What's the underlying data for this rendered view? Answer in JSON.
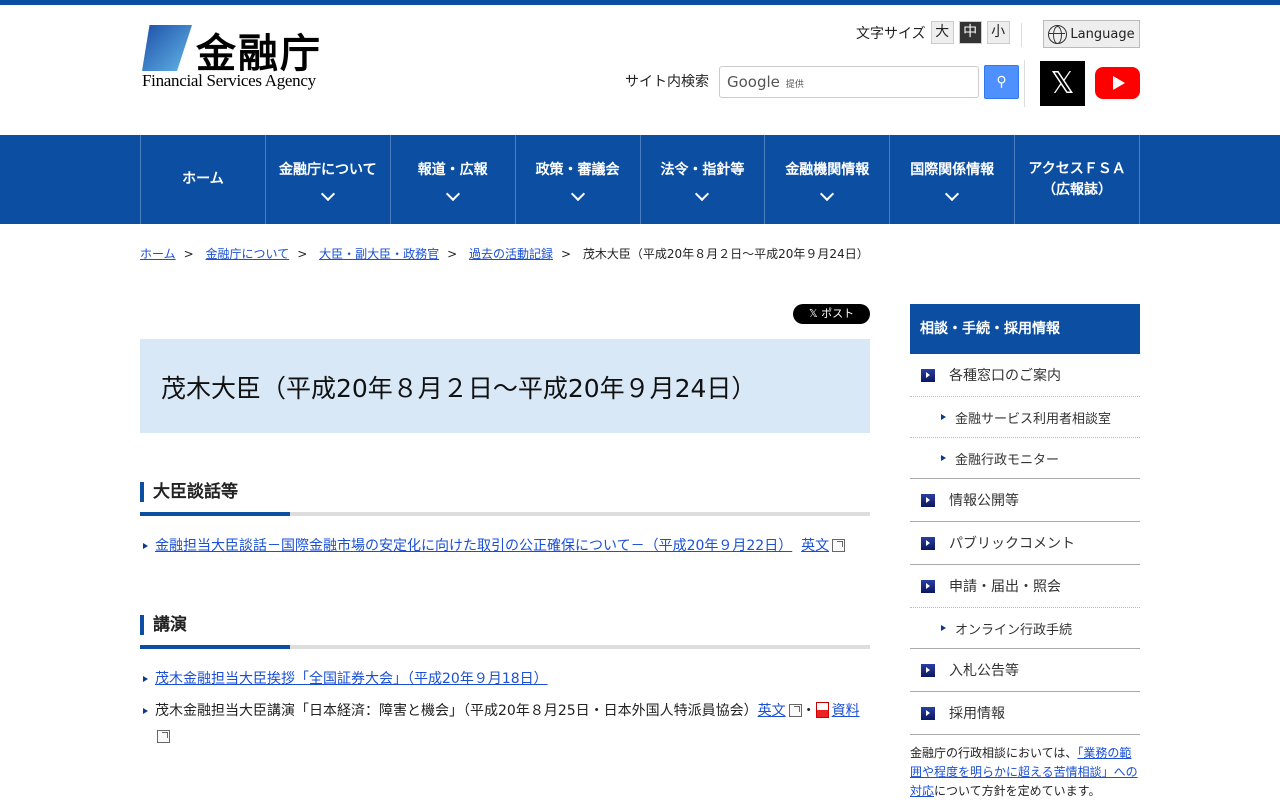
{
  "header": {
    "logo_kanji": "金融庁",
    "logo_en": "Financial Services Agency",
    "font_size_label": "文字サイズ",
    "font_sizes": [
      "大",
      "中",
      "小"
    ],
    "language": "Language",
    "search_label": "サイト内検索",
    "search_placeholder": "Google",
    "search_provided": "提供",
    "x_label": "𝕏"
  },
  "nav": [
    {
      "label": "ホーム"
    },
    {
      "label": "金融庁について"
    },
    {
      "label": "報道・広報"
    },
    {
      "label": "政策・審議会"
    },
    {
      "label": "法令・指針等"
    },
    {
      "label": "金融機関情報"
    },
    {
      "label": "国際関係情報"
    },
    {
      "label": "アクセスＦＳＡ（広報誌）"
    }
  ],
  "breadcrumb": [
    "ホーム",
    "金融庁について",
    "大臣・副大臣・政務官",
    "過去の活動記録"
  ],
  "breadcrumb_current": "茂木大臣（平成20年８月２日～平成20年９月24日）",
  "breadcrumb_sep": ">",
  "post_button": "𝕏 ポスト",
  "page_title": "茂木大臣（平成20年８月２日～平成20年９月24日）",
  "sections": [
    {
      "heading": "大臣談話等",
      "items": [
        {
          "link": "金融担当大臣談話－国際金融市場の安定化に向けた取引の公正確保について－（平成20年９月22日）",
          "en": "英文"
        }
      ]
    },
    {
      "heading": "講演",
      "items": [
        {
          "link": "茂木金融担当大臣挨拶「全国証券大会」（平成20年９月18日）"
        },
        {
          "text": "茂木金融担当大臣講演「日本経済：障害と機会」（平成20年８月25日・日本外国人特派員協会）",
          "en": "英文",
          "dot": "・",
          "material": "資料"
        }
      ]
    }
  ],
  "sidebar": {
    "heading": "相談・手続・採用情報",
    "items": [
      "各種窓口のご案内",
      "金融サービス利用者相談室",
      "金融行政モニター",
      "情報公開等",
      "パブリックコメント",
      "申請・届出・照会",
      "オンライン行政手続",
      "入札公告等",
      "採用情報"
    ],
    "note_pre": "金融庁の行政相談においては、",
    "note_link": "「業務の範囲や程度を明らかに超える苦情相談」への対応",
    "note_post": "について方針を定めています。"
  }
}
